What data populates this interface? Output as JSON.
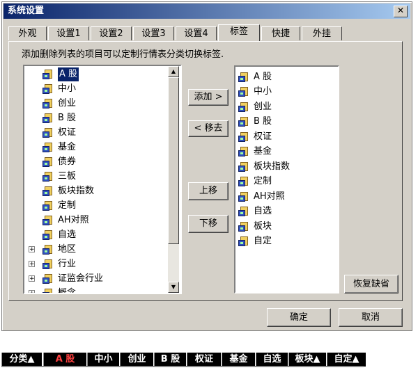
{
  "window": {
    "title": "系统设置",
    "close_glyph": "✕"
  },
  "tabs": [
    {
      "label": "外观"
    },
    {
      "label": "设置1"
    },
    {
      "label": "设置2"
    },
    {
      "label": "设置3"
    },
    {
      "label": "设置4"
    },
    {
      "label": "标签",
      "active": true
    },
    {
      "label": "快捷"
    },
    {
      "label": "外挂"
    }
  ],
  "hint": "添加删除列表的项目可以定制行情表分类切换标签.",
  "left_list": {
    "items": [
      {
        "label": "A 股",
        "selected": true
      },
      {
        "label": "中小"
      },
      {
        "label": "创业"
      },
      {
        "label": "B 股"
      },
      {
        "label": "权证"
      },
      {
        "label": "基金"
      },
      {
        "label": "债券"
      },
      {
        "label": "三板"
      },
      {
        "label": "板块指数"
      },
      {
        "label": "定制"
      },
      {
        "label": "AH对照"
      },
      {
        "label": "自选"
      },
      {
        "label": "地区",
        "expandable": true
      },
      {
        "label": "行业",
        "expandable": true
      },
      {
        "label": "证监会行业",
        "expandable": true
      },
      {
        "label": "概念",
        "expandable": true
      }
    ],
    "expand_glyph": "+"
  },
  "right_list": {
    "items": [
      {
        "label": "A 股"
      },
      {
        "label": "中小"
      },
      {
        "label": "创业"
      },
      {
        "label": "B 股"
      },
      {
        "label": "权证"
      },
      {
        "label": "基金"
      },
      {
        "label": "板块指数"
      },
      {
        "label": "定制"
      },
      {
        "label": "AH对照"
      },
      {
        "label": "自选"
      },
      {
        "label": "板块"
      },
      {
        "label": "自定"
      }
    ]
  },
  "buttons": {
    "add": "添加 >",
    "remove": "< 移去",
    "up": "上移",
    "down": "下移",
    "restore": "恢复缺省",
    "ok": "确定",
    "cancel": "取消"
  },
  "scroll": {
    "up": "▲",
    "down": "▼"
  },
  "bottom_tabs": [
    {
      "label": "分类▲"
    },
    {
      "label": "A 股",
      "active": true
    },
    {
      "label": "中小"
    },
    {
      "label": "创业"
    },
    {
      "label": "B 股"
    },
    {
      "label": "权证"
    },
    {
      "label": "基金"
    },
    {
      "label": "自选"
    },
    {
      "label": "板块▲"
    },
    {
      "label": "自定▲"
    }
  ]
}
